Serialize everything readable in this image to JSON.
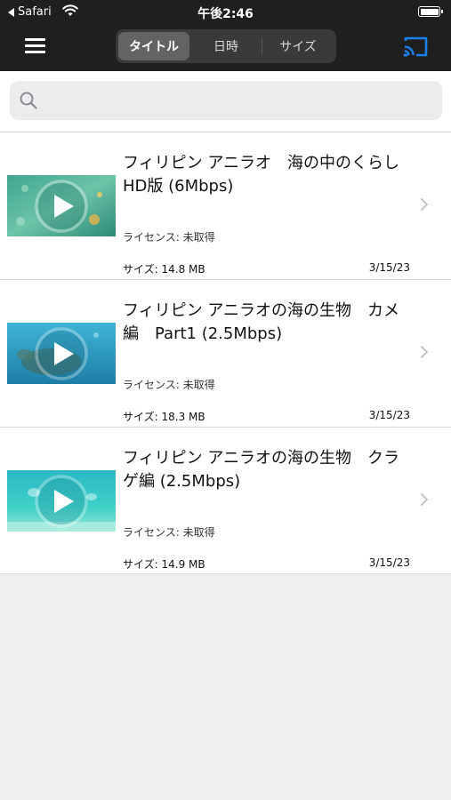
{
  "status_bar": {
    "back_label": "Safari",
    "time": "午後2:46"
  },
  "nav": {
    "menu_icon": "hamburger-menu-icon",
    "cast_icon": "cast-icon",
    "accent_color": "#1a7fe8",
    "segments": [
      {
        "label": "タイトル",
        "active": true
      },
      {
        "label": "日時",
        "active": false
      },
      {
        "label": "サイズ",
        "active": false
      }
    ]
  },
  "search": {
    "placeholder": "",
    "value": ""
  },
  "videos": [
    {
      "title": "フィリピン アニラオ　海の中のくらし　HD版 (6Mbps)",
      "license": "ライセンス: 未取得",
      "size": "サイズ: 14.8 MB",
      "date": "3/15/23"
    },
    {
      "title": "フィリピン アニラオの海の生物　カメ編　Part1 (2.5Mbps)",
      "license": "ライセンス: 未取得",
      "size": "サイズ: 18.3 MB",
      "date": "3/15/23"
    },
    {
      "title": "フィリピン アニラオの海の生物　クラゲ編 (2.5Mbps)",
      "license": "ライセンス: 未取得",
      "size": "サイズ: 14.9 MB",
      "date": "3/15/23"
    }
  ]
}
